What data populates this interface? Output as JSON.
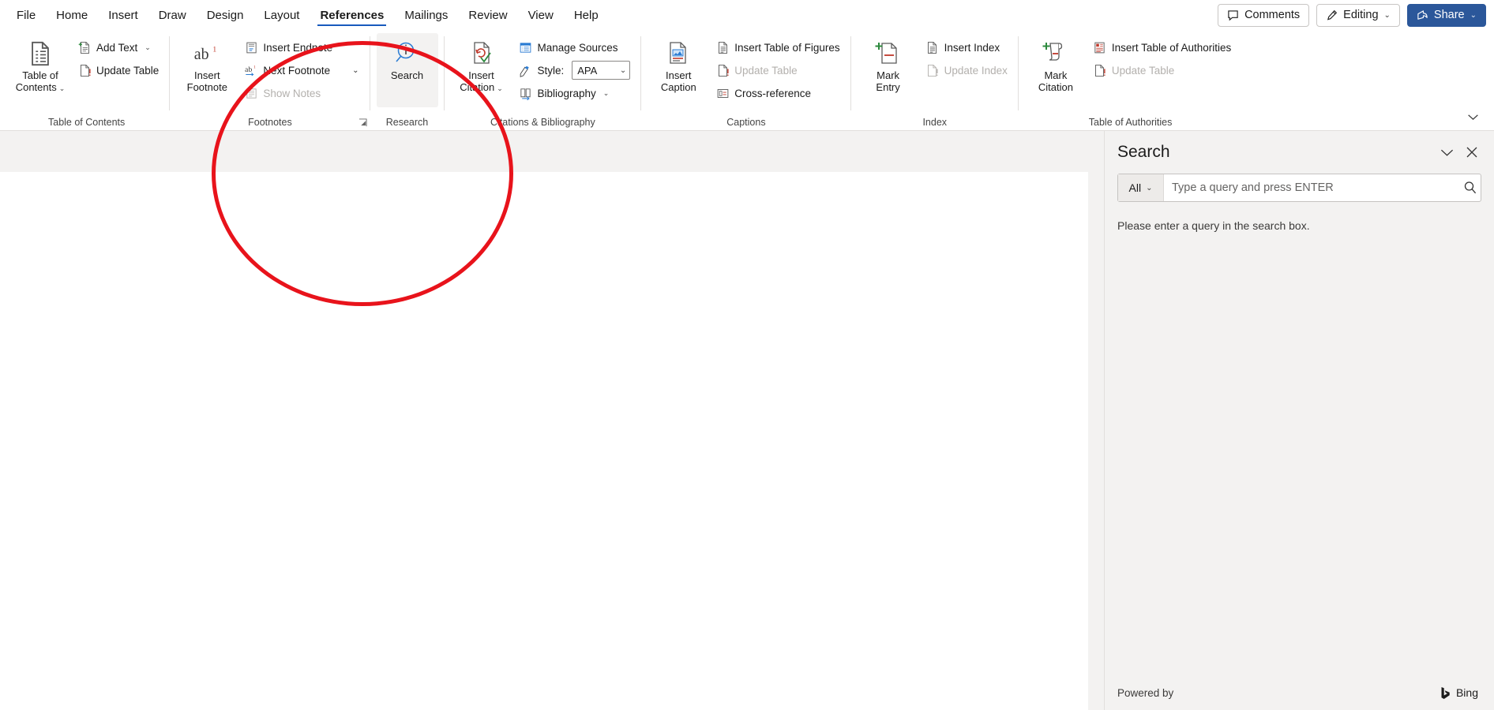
{
  "tabs": [
    {
      "label": "File",
      "active": false
    },
    {
      "label": "Home",
      "active": false
    },
    {
      "label": "Insert",
      "active": false
    },
    {
      "label": "Draw",
      "active": false
    },
    {
      "label": "Design",
      "active": false
    },
    {
      "label": "Layout",
      "active": false
    },
    {
      "label": "References",
      "active": true
    },
    {
      "label": "Mailings",
      "active": false
    },
    {
      "label": "Review",
      "active": false
    },
    {
      "label": "View",
      "active": false
    },
    {
      "label": "Help",
      "active": false
    }
  ],
  "topright": {
    "comments": "Comments",
    "comments_icon": "comment-icon",
    "editing": "Editing",
    "editing_icon": "pencil-icon",
    "share": "Share",
    "share_icon": "share-icon",
    "chevron": "⌄"
  },
  "ribbon": {
    "collapse_icon": "chevron-down-icon",
    "groups": [
      {
        "name": "table-of-contents",
        "label": "Table of Contents",
        "big": {
          "label": "Table of\nContents",
          "icon": "toc-icon",
          "dropdown": true,
          "highlight": false
        },
        "small": [
          {
            "label": "Add Text",
            "icon": "add-text-icon",
            "dropdown": true,
            "disabled": false
          },
          {
            "label": "Update Table",
            "icon": "update-table-icon",
            "dropdown": false,
            "disabled": false
          }
        ]
      },
      {
        "name": "footnotes",
        "label": "Footnotes",
        "dialog_launcher": "⤵",
        "big": {
          "label": "Insert\nFootnote",
          "icon": "ab-footnote-icon",
          "dropdown": false,
          "highlight": false
        },
        "small": [
          {
            "label": "Insert Endnote",
            "icon": "insert-endnote-icon",
            "dropdown": false,
            "disabled": false
          },
          {
            "label": "Next Footnote",
            "icon": "next-footnote-icon",
            "dropdown": true,
            "sep_dropdown": true,
            "disabled": false
          },
          {
            "label": "Show Notes",
            "icon": "show-notes-icon",
            "dropdown": false,
            "disabled": true
          }
        ]
      },
      {
        "name": "research",
        "label": "Research",
        "big": {
          "label": "Search",
          "icon": "search-research-icon",
          "dropdown": false,
          "highlight": true
        },
        "small": []
      },
      {
        "name": "citations-and-bibliography",
        "label": "Citations & Bibliography",
        "big": {
          "label": "Insert\nCitation",
          "icon": "insert-citation-icon",
          "dropdown": true,
          "highlight": false
        },
        "small": [
          {
            "label": "Manage Sources",
            "icon": "manage-sources-icon",
            "dropdown": false,
            "disabled": false
          },
          {
            "label": "Style:",
            "icon": "style-icon",
            "dropdown": false,
            "disabled": false,
            "combo": "APA"
          },
          {
            "label": "Bibliography",
            "icon": "bibliography-icon",
            "dropdown": true,
            "disabled": false
          }
        ]
      },
      {
        "name": "captions",
        "label": "Captions",
        "big": {
          "label": "Insert\nCaption",
          "icon": "insert-caption-icon",
          "dropdown": false,
          "highlight": false
        },
        "small": [
          {
            "label": "Insert Table of Figures",
            "icon": "insert-table-of-figures-icon",
            "dropdown": false,
            "disabled": false
          },
          {
            "label": "Update Table",
            "icon": "update-table-icon",
            "dropdown": false,
            "disabled": true
          },
          {
            "label": "Cross-reference",
            "icon": "cross-reference-icon",
            "dropdown": false,
            "disabled": false
          }
        ]
      },
      {
        "name": "index",
        "label": "Index",
        "big": {
          "label": "Mark\nEntry",
          "icon": "mark-entry-icon",
          "dropdown": false,
          "highlight": false
        },
        "small": [
          {
            "label": "Insert Index",
            "icon": "insert-index-icon",
            "dropdown": false,
            "disabled": false
          },
          {
            "label": "Update Index",
            "icon": "update-index-icon",
            "dropdown": false,
            "disabled": true
          }
        ]
      },
      {
        "name": "table-of-authorities",
        "label": "Table of Authorities",
        "big": {
          "label": "Mark\nCitation",
          "icon": "mark-citation-icon",
          "dropdown": false,
          "highlight": false
        },
        "small": [
          {
            "label": "Insert Table of Authorities",
            "icon": "insert-table-of-authorities-icon",
            "dropdown": false,
            "disabled": false
          },
          {
            "label": "Update Table",
            "icon": "update-table-icon",
            "dropdown": false,
            "disabled": true
          }
        ]
      }
    ]
  },
  "pane": {
    "title": "Search",
    "collapse_icon": "chevron-down-icon",
    "close_icon": "close-icon",
    "scope_value": "All",
    "scope_chevron": "⌄",
    "query_value": "",
    "query_placeholder": "Type a query and press ENTER",
    "search_icon": "search-icon",
    "message": "Please enter a query in the search box.",
    "footer_label": "Powered by",
    "footer_brand": "Bing",
    "footer_brand_icon": "bing-logo-icon"
  },
  "annotation": {
    "shape": "red-ellipse-highlight",
    "color": "#e8131b"
  }
}
